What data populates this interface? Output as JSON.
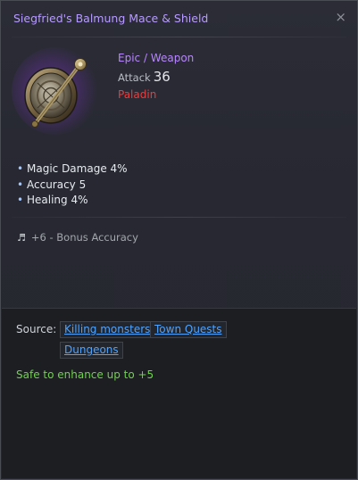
{
  "window": {
    "title": "Siegfried's Balmung Mace & Shield",
    "close_glyph": "×"
  },
  "item": {
    "icon": "mace-and-shield-icon",
    "rarity_type": "Epic / Weapon",
    "attack_label": "Attack",
    "attack_value": "36",
    "class": "Paladin"
  },
  "stats": [
    {
      "text": "Magic Damage 4%"
    },
    {
      "text": "Accuracy 5"
    },
    {
      "text": "Healing 4%"
    }
  ],
  "bonus": {
    "icon": "music-note-icon",
    "text": "+6 - Bonus Accuracy"
  },
  "source": {
    "label": "Source:",
    "links": [
      "Killing monsters",
      "Town Quests",
      "Dungeons"
    ]
  },
  "enhance_text": "Safe to enhance up to +5",
  "colors": {
    "title": "#b79cff",
    "rarity": "#b886ff",
    "class": "#ef3b3b",
    "link": "#4ea3ff",
    "safe": "#6fd34a"
  }
}
